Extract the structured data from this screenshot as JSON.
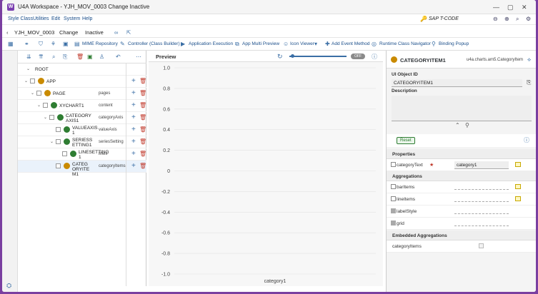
{
  "window": {
    "title": "U4A Workspace - YJH_MOV_0003 Change Inactive",
    "logo": "W"
  },
  "menu": {
    "items": [
      "Style Class",
      "Utilities",
      "Edit",
      "System",
      "Help"
    ],
    "tcode": "SAP T-CODE"
  },
  "object": {
    "name": "YJH_MOV_0003",
    "mode": "Change",
    "status": "Inactive"
  },
  "toolbar": {
    "mime": "MIME Repository",
    "controller": "Controller (Class Builder)",
    "app_exec": "Application Execution",
    "multi_preview": "App Multi Preview",
    "icon_viewer": "Icon Viewer",
    "add_event": "Add Event Method",
    "runtime_nav": "Runtime Class Navigator",
    "binding_popup": "Binding Popup"
  },
  "tree": {
    "root": "ROOT",
    "rows": [
      {
        "name": "APP",
        "agg": "",
        "icon": "#c98a00",
        "lvl": 1
      },
      {
        "name": "PAGE",
        "agg": "pages",
        "icon": "#c98a00",
        "lvl": 2
      },
      {
        "name": "XYCHART1",
        "agg": "content",
        "icon": "#2e7d32",
        "lvl": 3
      },
      {
        "name": "CATEGORYAXIS1",
        "agg": "categoryAxis",
        "icon": "#2e7d32",
        "lvl": 4,
        "l1": "CATEGORY",
        "l2": "AXIS1"
      },
      {
        "name": "VALUEAXIS1",
        "agg": "valueAxis",
        "icon": "#2e7d32",
        "lvl": 5,
        "l1": "VALUEAXIS",
        "l2": "1"
      },
      {
        "name": "SERIESSETTING1",
        "agg": "seriesSetting",
        "icon": "#2e7d32",
        "lvl": 5,
        "l1": "SERIESS",
        "l2": "ETTING1"
      },
      {
        "name": "LINESETTING1",
        "agg": "lines",
        "icon": "#2e7d32",
        "lvl": 6,
        "l1": "LINESETTING",
        "l2": "1"
      },
      {
        "name": "CATEGORYITEM1",
        "agg": "categoryItems",
        "icon": "#c98a00",
        "lvl": 5,
        "l1": "CATEG",
        "l2": "ORYITE",
        "l3": "M1"
      }
    ]
  },
  "preview": {
    "title": "Preview",
    "toggle": "OFF"
  },
  "chart_data": {
    "type": "line",
    "categories": [
      "category1"
    ],
    "ylim": [
      -1.0,
      1.0
    ],
    "yticks": [
      "1.0",
      "0.8",
      "0.6",
      "0.4",
      "0.2",
      "0",
      "-0.2",
      "-0.4",
      "-0.6",
      "-0.8",
      "-1.0"
    ],
    "series": []
  },
  "props": {
    "object": "CATEGORYITEM1",
    "class": "u4a.charts.am5.CategoryItem",
    "ui_label": "UI Object ID",
    "ui_value": "CATEGORYITEM1",
    "desc_label": "Description",
    "reset": "Reset",
    "properties": "Properties",
    "category_text_label": "categoryText",
    "category_text_value": "category1",
    "aggregations": "Aggregations",
    "agg_items": [
      "barItems",
      "lineItems",
      "labelStyle",
      "grid"
    ],
    "embedded": "Embedded Aggregations",
    "embedded_item": "categoryItems"
  }
}
